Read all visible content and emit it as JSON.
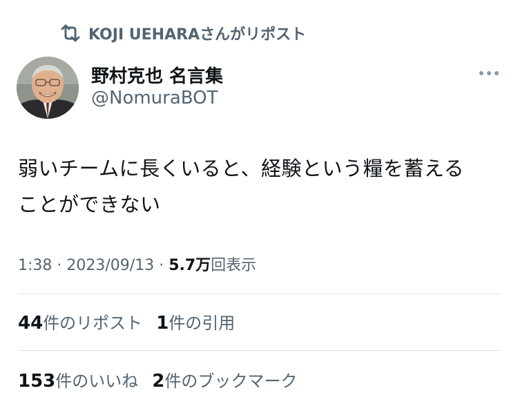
{
  "retweet_banner": {
    "text": "KOJI  UEHARAさんがリポスト",
    "icon": "retweet-icon"
  },
  "author": {
    "display_name": "野村克也 名言集",
    "handle": "@NomuraBOT",
    "avatar_icon": "avatar"
  },
  "more_menu_icon": "more-horizontal-icon",
  "tweet": {
    "line1": "弱いチームに長くいると、経験という糧を蓄える",
    "line2": "ことができない"
  },
  "meta": {
    "time": "1:38",
    "dot1": " · ",
    "date": "2023/09/13",
    "dot2": " · ",
    "views_count": "5.7万",
    "views_label": "回表示"
  },
  "stats": {
    "reposts_count": "44",
    "reposts_label": "件のリポスト",
    "quotes_count": "1",
    "quotes_label": "件の引用",
    "likes_count": "153",
    "likes_label": "件のいいね",
    "bookmarks_count": "2",
    "bookmarks_label": "件のブックマーク"
  },
  "colors": {
    "text_primary": "#0f1419",
    "text_secondary": "#536471",
    "divider": "#e1e5e8"
  }
}
